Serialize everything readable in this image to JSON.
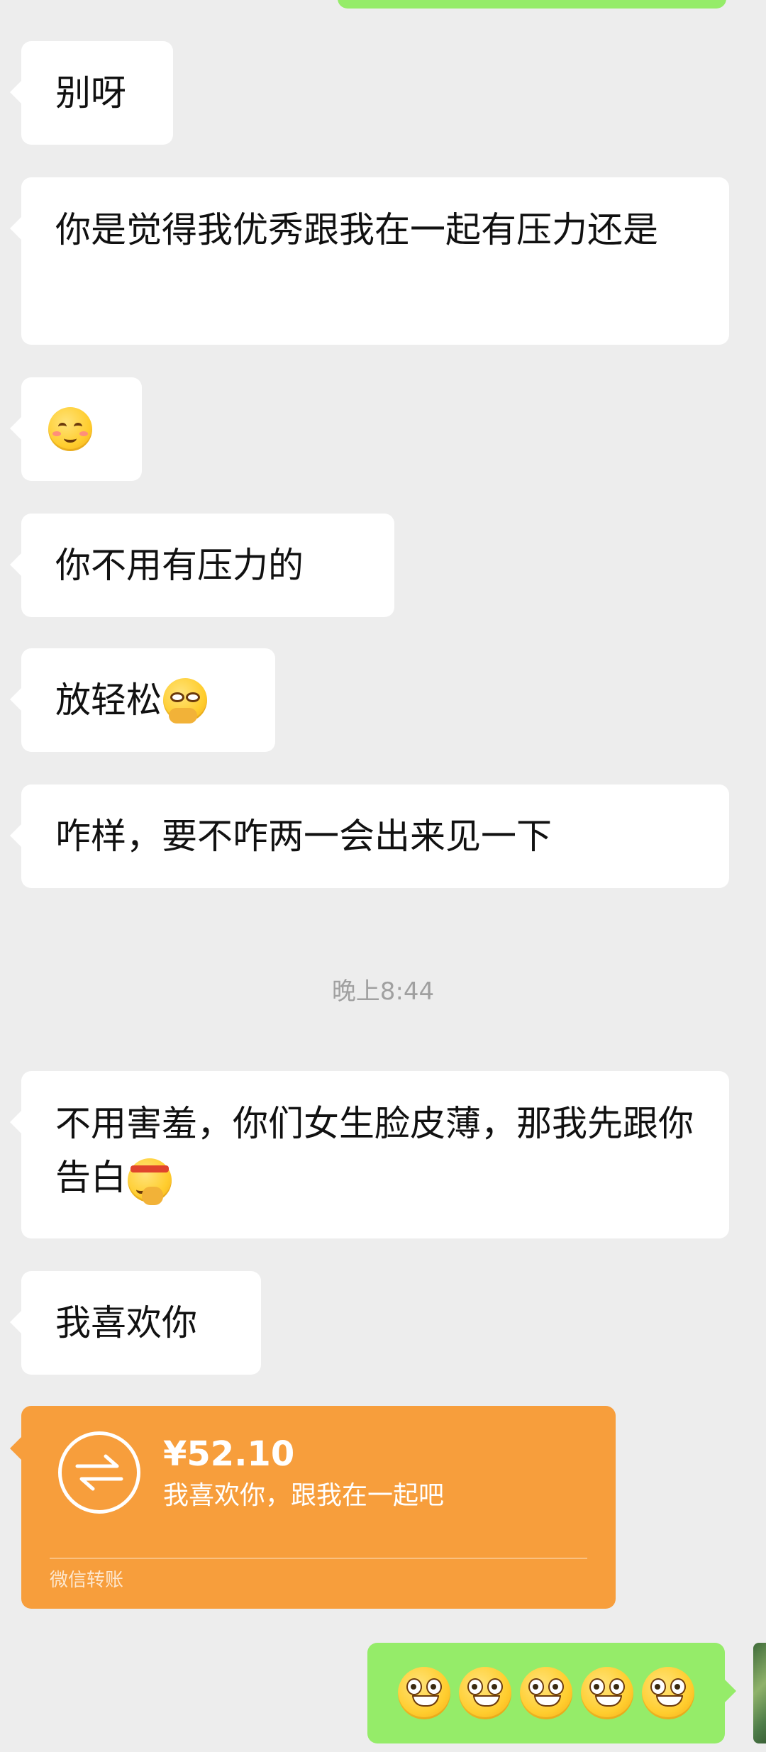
{
  "messages": [
    {
      "id": "m1",
      "text": "别呀"
    },
    {
      "id": "m2",
      "text": "你是觉得我优秀跟我在一起有压力还是"
    },
    {
      "id": "m3",
      "emoji": "smiling-blush-emoji"
    },
    {
      "id": "m4",
      "text": "你不用有压力的"
    },
    {
      "id": "m5",
      "text": "放轻松",
      "emoji": "thinking-emoji"
    },
    {
      "id": "m6",
      "text": "咋样，要不咋两一会出来见一下"
    },
    {
      "id": "m7",
      "text": "不用害羞，你们女生脸皮薄，那我先跟你告白",
      "emoji": "headband-emoji"
    },
    {
      "id": "m8",
      "text": "我喜欢你"
    }
  ],
  "timestamp": "晚上8:44",
  "transfer": {
    "amount": "¥52.10",
    "note": "我喜欢你，跟我在一起吧",
    "label": "微信转账",
    "icon": "transfer-arrows-icon",
    "color": "#f79e3c"
  },
  "reply": {
    "emoji": "grin-emoji",
    "count": 5,
    "color": "#95ec69"
  },
  "colors": {
    "background": "#ededed",
    "bubble_in": "#ffffff",
    "bubble_out": "#95ec69"
  }
}
